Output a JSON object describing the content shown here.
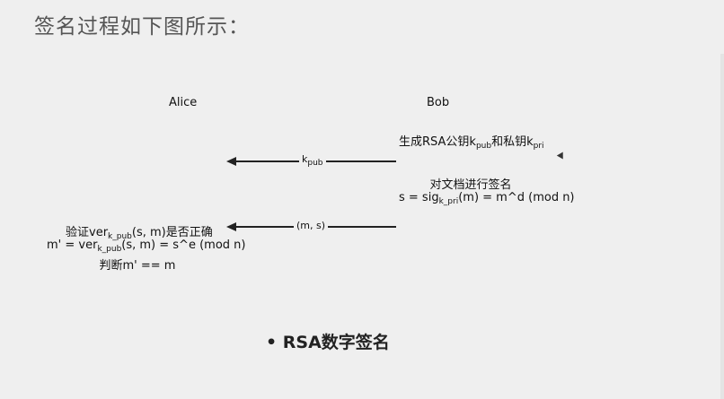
{
  "heading": "签名过程如下图所示：",
  "actors": {
    "alice": "Alice",
    "bob": "Bob"
  },
  "bob_steps": {
    "gen_keys": {
      "a": "生成RSA公钥k",
      "b": "pub",
      "c": "和私钥k",
      "d": "pri"
    },
    "sign_title": "对文档进行签名",
    "sign_formula": {
      "a": "s = sig",
      "b": "k_pri",
      "c": "(m) = m^d (mod n)"
    }
  },
  "arrows": {
    "first": {
      "label_main": "k",
      "label_sub": "pub"
    },
    "second": {
      "label": "(m, s)"
    }
  },
  "alice_steps": {
    "verify_title": {
      "a": "验证ver",
      "b": "k_pub",
      "c": "(s, m)是否正确"
    },
    "verify_formula": {
      "a": "m' = ver",
      "b": "k_pub",
      "c": "(s, m) = s^e (mod n)"
    },
    "judge": "判断m' == m"
  },
  "bullet": {
    "symbol": "•",
    "text": "RSA数字签名"
  }
}
